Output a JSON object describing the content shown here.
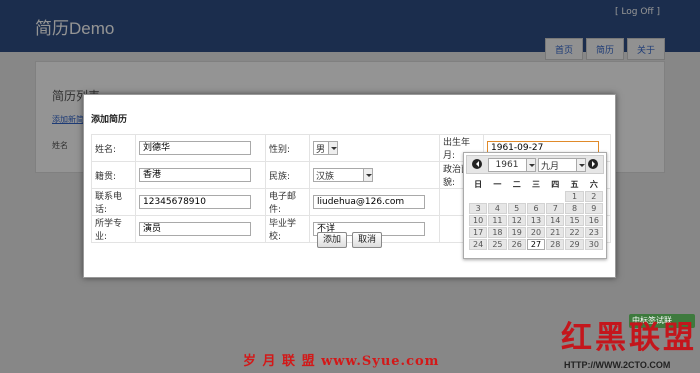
{
  "app": {
    "title": "简历Demo",
    "logout": "[ Log Off ]"
  },
  "nav": {
    "tabs": [
      "首页",
      "简历",
      "关于"
    ]
  },
  "panel": {
    "heading": "简历列表",
    "link": "添加新简历",
    "column": "姓名"
  },
  "modal": {
    "title": "添加简历",
    "fields": {
      "name": {
        "label": "姓名:",
        "value": "刘德华"
      },
      "gender": {
        "label": "性别:",
        "value": "男"
      },
      "birth": {
        "label": "出生年月:",
        "value": "1961-09-27"
      },
      "origin": {
        "label": "籍贯:",
        "value": "香港"
      },
      "ethnicity": {
        "label": "民族:",
        "value": "汉族"
      },
      "politics": {
        "label": "政治面貌:",
        "value": ""
      },
      "phone": {
        "label": "联系电话:",
        "value": "12345678910"
      },
      "email": {
        "label": "电子邮件:",
        "value": "liudehua@126.com"
      },
      "major": {
        "label": "所学专业:",
        "value": "演员"
      },
      "school": {
        "label": "毕业学校:",
        "value": "不详"
      }
    },
    "buttons": {
      "add": "添加",
      "cancel": "取消"
    }
  },
  "datepicker": {
    "year": "1961",
    "month": "九月",
    "weekdays": [
      "日",
      "一",
      "二",
      "三",
      "四",
      "五",
      "六"
    ],
    "weeks": [
      [
        "",
        "",
        "",
        "",
        "",
        "1",
        "2"
      ],
      [
        "3",
        "4",
        "5",
        "6",
        "7",
        "8",
        "9"
      ],
      [
        "10",
        "11",
        "12",
        "13",
        "14",
        "15",
        "16"
      ],
      [
        "17",
        "18",
        "19",
        "20",
        "21",
        "22",
        "23"
      ],
      [
        "24",
        "25",
        "26",
        "27",
        "28",
        "29",
        "30"
      ]
    ],
    "selected": "27"
  },
  "watermarks": {
    "left": "岁 月 联 盟   www.Syue.com",
    "right": "红黑联盟",
    "right_url": "HTTP://WWW.2CTO.COM",
    "stamp": "中标签试联"
  }
}
